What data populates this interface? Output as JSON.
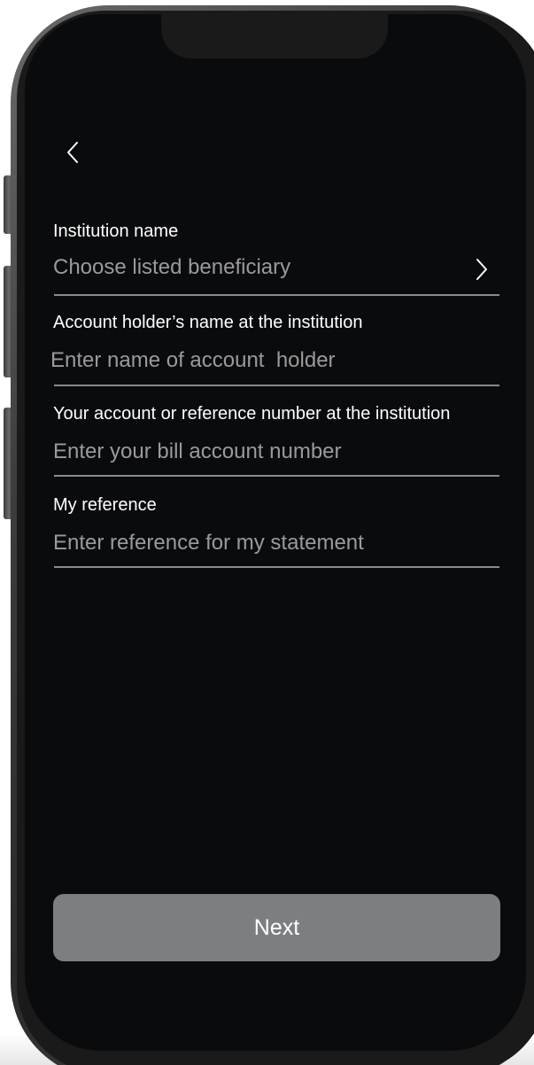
{
  "form": {
    "institution": {
      "label": "Institution name",
      "value": "Choose listed beneficiary"
    },
    "account_holder": {
      "label": "Account holder’s name at the institution",
      "placeholder": "Enter name of account  holder"
    },
    "account_number": {
      "label": "Your account or reference number at the institution",
      "placeholder": "Enter your bill account number"
    },
    "my_reference": {
      "label": "My reference",
      "placeholder": "Enter reference for my statement"
    }
  },
  "actions": {
    "next_label": "Next"
  },
  "icons": {
    "back": "chevron-left-icon",
    "select": "chevron-right-icon"
  },
  "colors": {
    "screen_bg": "#0a0b0d",
    "button_bg": "#7c7f81",
    "placeholder": "#9a9a9a",
    "divider": "#8a8a8a"
  }
}
